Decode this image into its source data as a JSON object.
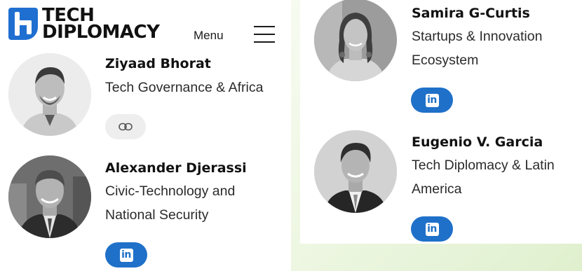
{
  "header": {
    "brand_line1": "TECH",
    "brand_line2": "DIPLOMACY",
    "menu_label": "Menu",
    "menu_icon": "hamburger-icon",
    "accent_color": "#1f6fd1"
  },
  "people": [
    {
      "name": "Ziyaad Bhorat",
      "role": "Tech Governance & Africa",
      "link_type": "link-icon"
    },
    {
      "name": "Alexander Djerassi",
      "role": "Civic-Technology and National Security",
      "link_type": "linkedin-icon"
    },
    {
      "name": "Samira G-Curtis",
      "role": "Startups & Innovation Ecosystem",
      "link_type": "linkedin-icon"
    },
    {
      "name": "Eugenio V. Garcia",
      "role": "Tech Diplomacy & Latin America",
      "link_type": "linkedin-icon"
    }
  ],
  "linkedin_glyph": "in",
  "linkedin_color": "#1f70c9"
}
